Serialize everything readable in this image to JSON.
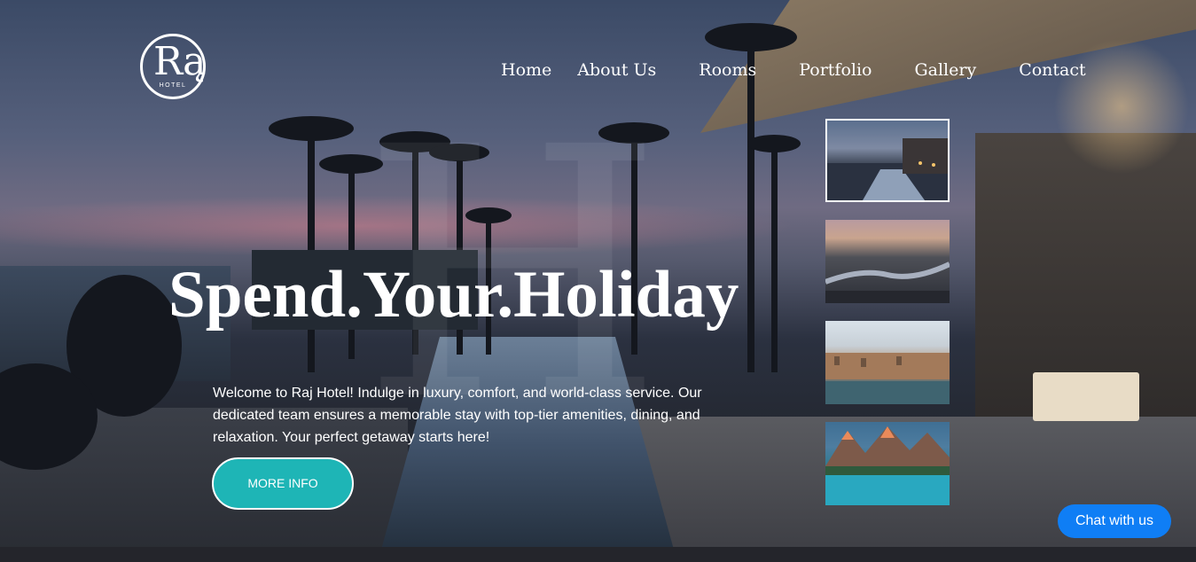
{
  "brand": {
    "logo_letters": "Rą",
    "logo_subtext": "HOTEL"
  },
  "nav": [
    {
      "label": "Home"
    },
    {
      "label": "About Us"
    },
    {
      "label": "Rooms"
    },
    {
      "label": "Portfolio"
    },
    {
      "label": "Gallery"
    },
    {
      "label": "Contact"
    }
  ],
  "hero": {
    "headline": "Spend.Your.Holiday",
    "description": "Welcome to Raj Hotel! Indulge in luxury, comfort, and world-class service. Our dedicated team ensures a memorable stay with top-tier amenities, dining, and relaxation. Your perfect getaway starts here!",
    "cta_label": "MORE INFO",
    "watermark_text": "H"
  },
  "gallery_thumbnails": [
    {
      "name": "resort-evening",
      "active": true
    },
    {
      "name": "city-river-sunset",
      "active": false
    },
    {
      "name": "venice-canal",
      "active": false
    },
    {
      "name": "mountain-lake",
      "active": false
    }
  ],
  "chat": {
    "label": "Chat with us"
  },
  "colors": {
    "cta": "#1eb5b6",
    "chat": "#0f7ef5",
    "footer": "#24252b"
  }
}
